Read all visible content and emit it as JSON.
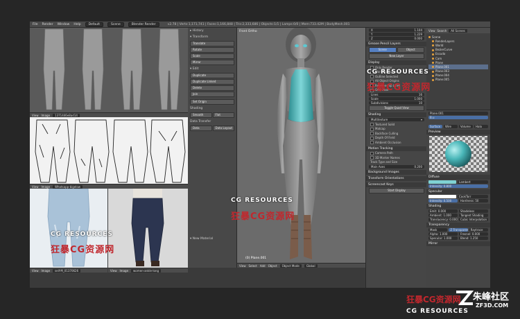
{
  "topbar": {
    "menus": [
      "File",
      "Render",
      "Window",
      "Help"
    ],
    "layout": "Default",
    "scene": "Scene",
    "engine": "Blender Render",
    "info": "v2.78 | Verts:1,171,741 | Faces:1,166,848 | Tris:2,333,686 | Objects:1/1 | Lamps:0/0 | Mem:733.42M | BodyMesh.001"
  },
  "ref_panels": {
    "bar1": {
      "items": [
        "View",
        "Image",
        "Image"
      ],
      "name": "1371446e8ad14"
    },
    "bar2": {
      "items": [
        "View",
        "Image"
      ],
      "name": "Whatsapp-bigelow"
    },
    "bar3": {
      "items": [
        "View",
        "Image"
      ],
      "name": "seif-M_01370626"
    },
    "bar4": {
      "items": [
        "View",
        "Image"
      ],
      "name": "women-ankle-long"
    }
  },
  "tool_shelf": {
    "sections": [
      {
        "title": "History",
        "buttons": []
      },
      {
        "title": "Transform",
        "buttons": [
          "Translate",
          "Rotate",
          "Scale",
          "Mirror"
        ]
      },
      {
        "title": "Edit",
        "buttons": [
          "Duplicate",
          "Duplicate Linked",
          "Delete",
          "Join"
        ]
      },
      {
        "title": "",
        "buttons": [
          "Set Origin"
        ]
      },
      {
        "title": "Shading",
        "buttons": []
      }
    ],
    "shading_row": [
      "Smooth",
      "Flat"
    ],
    "data_transfer": "Data Transfer",
    "data_row": [
      "Data",
      "Data Layout"
    ],
    "new_material": "New Material"
  },
  "viewport": {
    "label": "Front Ortho",
    "object_label": "(0) Plane.001",
    "footer": [
      "View",
      "Select",
      "Add",
      "Object",
      "Object Mode",
      "Global"
    ]
  },
  "properties": {
    "top_fields": [
      {
        "k": "X",
        "v": "1.104"
      },
      {
        "k": "Y",
        "v": "1.229"
      },
      {
        "k": "Z",
        "v": "0.000"
      }
    ],
    "grease_pencil": "Grease Pencil Layers",
    "gp_tabs": [
      "Scene",
      "Object"
    ],
    "new_layer": "New Layer",
    "display_title": "Display",
    "display_items": [
      "Only Render",
      "World Background",
      "Outline Selected",
      "All Object Origins",
      "Relationship Lines"
    ],
    "grid_floor": "Grid Floor",
    "grid_fields": [
      {
        "k": "Lines",
        "v": "16"
      },
      {
        "k": "Scale",
        "v": "1.000"
      },
      {
        "k": "Subdivisions",
        "v": "10"
      }
    ],
    "toggle_quad": "Toggle Quad View",
    "shading_title": "Shading",
    "shading_mode": "Multitexture",
    "shading_items": [
      "Textured Solid",
      "Matcap",
      "Backface Culling",
      "Depth Of Field",
      "Ambient Occlusion"
    ],
    "motion_tracking": "Motion Tracking",
    "motion_items": [
      "Camera Path",
      "3D Marker Names"
    ],
    "track_label": "Track Type and Size",
    "main_axes": "Main Axes",
    "main_axes_value": "0.200",
    "background_images": "Background Images",
    "transform_orientations": "Transform Orientations",
    "screencast": "Screencast Keys",
    "start_display": "Start Display"
  },
  "outliner": {
    "header": [
      "View",
      "Search",
      "All Scenes"
    ],
    "items": [
      "Scene",
      "RenderLayers",
      "World",
      "BezierCurve",
      "Escudo",
      "Cam",
      "Plane",
      "Plane.001",
      "Plane.003",
      "Plane.004",
      "Plane.005"
    ]
  },
  "material_panel": {
    "object": "Plane.001",
    "material": "B.u",
    "tabs": [
      "Surface",
      "Wire",
      "Volume",
      "Halo"
    ],
    "preview": "Preview",
    "diffuse": "Diffuse",
    "diffuse_shader": "Lambert",
    "intensity": "Intensity: 0.800",
    "specular": "Specular",
    "spec_shader": "CookTorr",
    "spec_intensity": "Intensity: 0.500",
    "hardness": "Hardness: 50",
    "shading": "Shading",
    "shading_rows": [
      [
        "Emit: 0.000",
        "Shadeless"
      ],
      [
        "Ambient: 1.000",
        "Tangent Shading"
      ],
      [
        "Translucency: 0.000",
        "Cubic Interpolation"
      ]
    ],
    "transparency": "Transparency",
    "transparency_modes": [
      "Mask",
      "Z Transparency",
      "Raytrace"
    ],
    "alpha_row": [
      "Alpha: 1.000",
      "Fresnel: 0.000"
    ],
    "spec_row": [
      "Specular: 1.000",
      "Blend: 1.250"
    ],
    "mirror": "Mirror",
    "colors": {
      "diffuse": "#7fd2d4",
      "spec": "#ffffff",
      "sphere": "#49b6b8"
    }
  },
  "watermarks": {
    "en": "CG RESOURCES",
    "cn": "狂暴CG资源网",
    "brand_cn": "朱峰社区",
    "brand_en": "ZF3D.COM"
  }
}
